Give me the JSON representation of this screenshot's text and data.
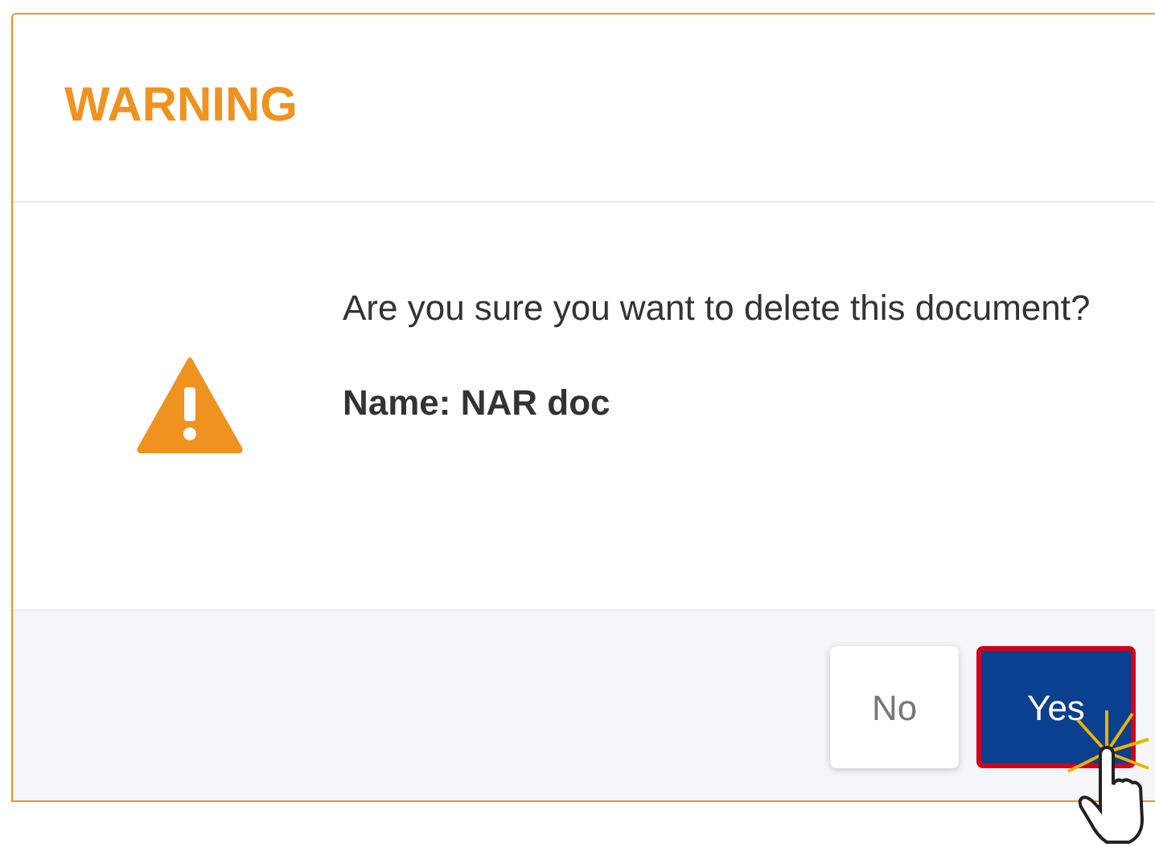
{
  "dialog": {
    "title": "WARNING",
    "message": "Are you sure you want to delete this document?",
    "detail": "Name: NAR doc",
    "buttons": [
      {
        "label": "No",
        "kind": "secondary",
        "highlighted": false
      },
      {
        "label": "Yes",
        "kind": "primary",
        "highlighted": true
      }
    ]
  }
}
